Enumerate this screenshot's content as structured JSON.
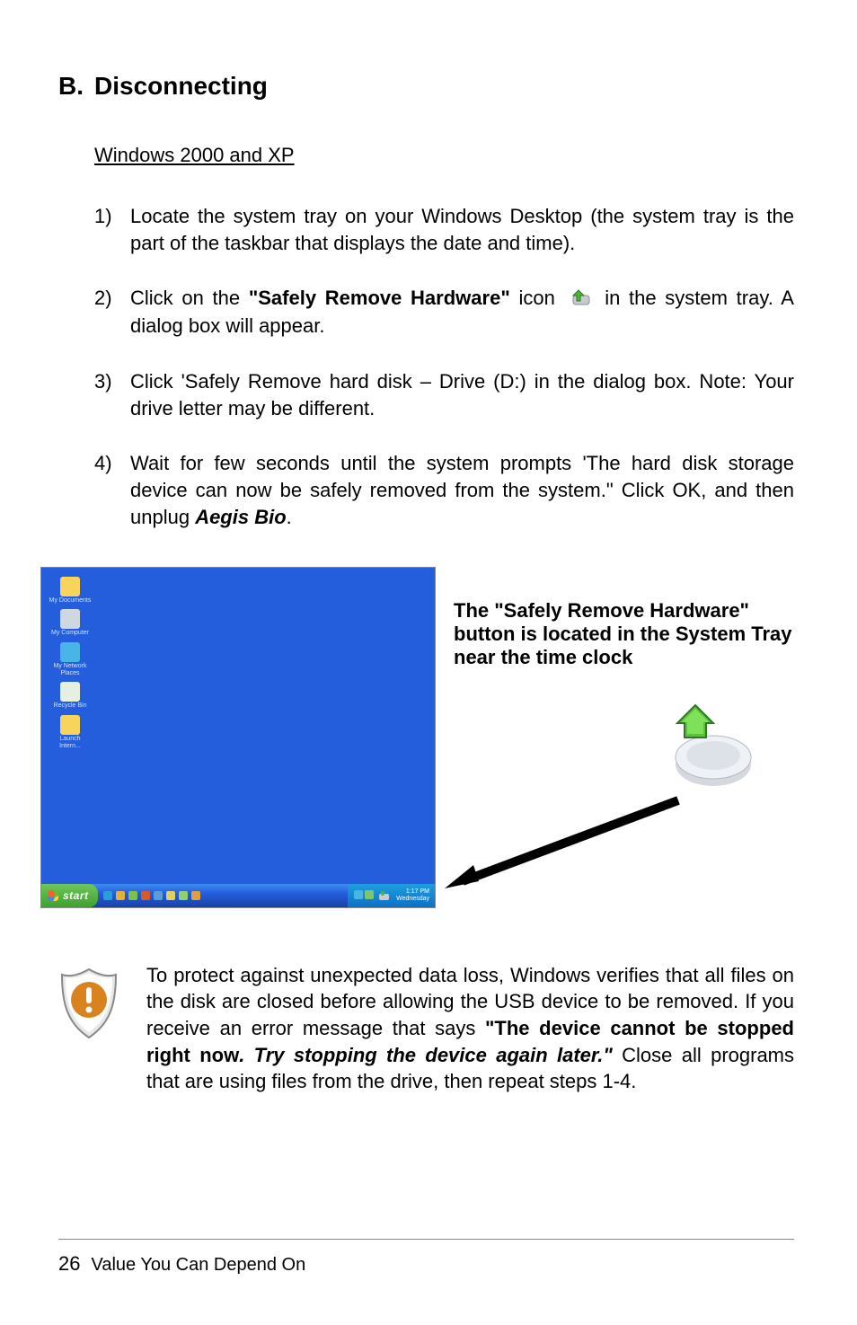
{
  "section": {
    "letter": "B.",
    "title": "Disconnecting"
  },
  "subheading": "Windows 2000 and XP",
  "steps": [
    {
      "num": "1)",
      "text_a": "Locate the system tray on your Windows Desktop (the system tray is the part of the taskbar that displays the date and time)."
    },
    {
      "num": "2)",
      "text_a": "Click on the ",
      "bold": "\"Safely Remove Hardware\"",
      "text_b": " icon ",
      "text_c": " in the system tray. A dialog box will appear."
    },
    {
      "num": "3)",
      "text_a": "Click 'Safely Remove hard disk – Drive (D:) in the dialog box. Note: Your drive letter may be different."
    },
    {
      "num": "4)",
      "text_a": "Wait for few seconds until the system prompts 'The hard disk storage device can now be safely removed from the system.\" Click OK, and then unplug ",
      "bolditalic": "Aegis Bio",
      "text_b": "."
    }
  ],
  "desktop": {
    "icons": [
      {
        "label": "My Documents",
        "bg": "#f7d45b"
      },
      {
        "label": "My Computer",
        "bg": "#cfd7e1"
      },
      {
        "label": "My Network Places",
        "bg": "#49b5e7"
      },
      {
        "label": "Recycle Bin",
        "bg": "#e6f0e0"
      },
      {
        "label": "Launch Intern...",
        "bg": "#f7d45b"
      }
    ],
    "start_label": "start",
    "quick_colors": [
      "#2a9ed8",
      "#e8b03a",
      "#7cc24a",
      "#d85a2a",
      "#5a9ed8",
      "#e0d060",
      "#8fd070",
      "#e0a040"
    ],
    "sys_colors": [
      "#49b5e7",
      "#7fc56a"
    ],
    "time_line1": "1:17 PM",
    "time_line2": "Wednesday"
  },
  "figure_caption": {
    "line1": "The \"Safely Remove Hardware\"",
    "line2": "button is located in the System Tray",
    "line3": "near the time clock"
  },
  "note": {
    "p1": "To protect against unexpected data loss, Windows verifies that all files on the disk are closed before allowing the USB device to be removed. If you receive an error message that says ",
    "bold": "\"The device cannot be stopped right now",
    "bolditalic": ". Try stopping the device again later.\"",
    "p2": " Close all programs that are using files from the drive, then repeat steps 1-4."
  },
  "footer": {
    "page": "26",
    "text": "Value You Can Depend On"
  }
}
